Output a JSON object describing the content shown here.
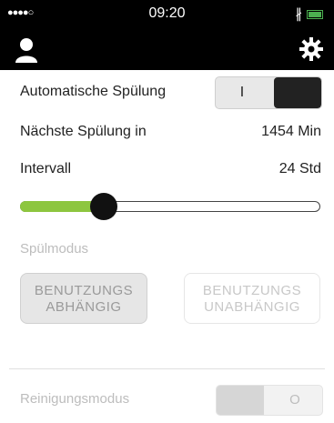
{
  "status": {
    "dots": "●●●●○",
    "time": "09:20",
    "bluetooth": "∦"
  },
  "header": {
    "user_icon": "user-icon",
    "settings_icon": "gear-icon"
  },
  "auto_flush": {
    "label": "Automatische Spülung",
    "toggle_on_label": "I"
  },
  "next_flush": {
    "label": "Nächste Spülung in",
    "value": "1454 Min"
  },
  "interval": {
    "label": "Intervall",
    "value": "24 Std",
    "level": 0.28
  },
  "flush_mode": {
    "label": "Spülmodus",
    "option_a_line1": "BENUTZUNGS",
    "option_a_line2": "ABHÄNGIG",
    "option_b_line1": "BENUTZUNGS",
    "option_b_line2": "UNABHÄNGIG"
  },
  "cleaning_mode": {
    "label": "Reinigungsmodus",
    "toggle_off_label": "O"
  },
  "colors": {
    "accent_green": "#8dc63f",
    "header": "#000000",
    "disabled_text": "#bdbdbd"
  }
}
